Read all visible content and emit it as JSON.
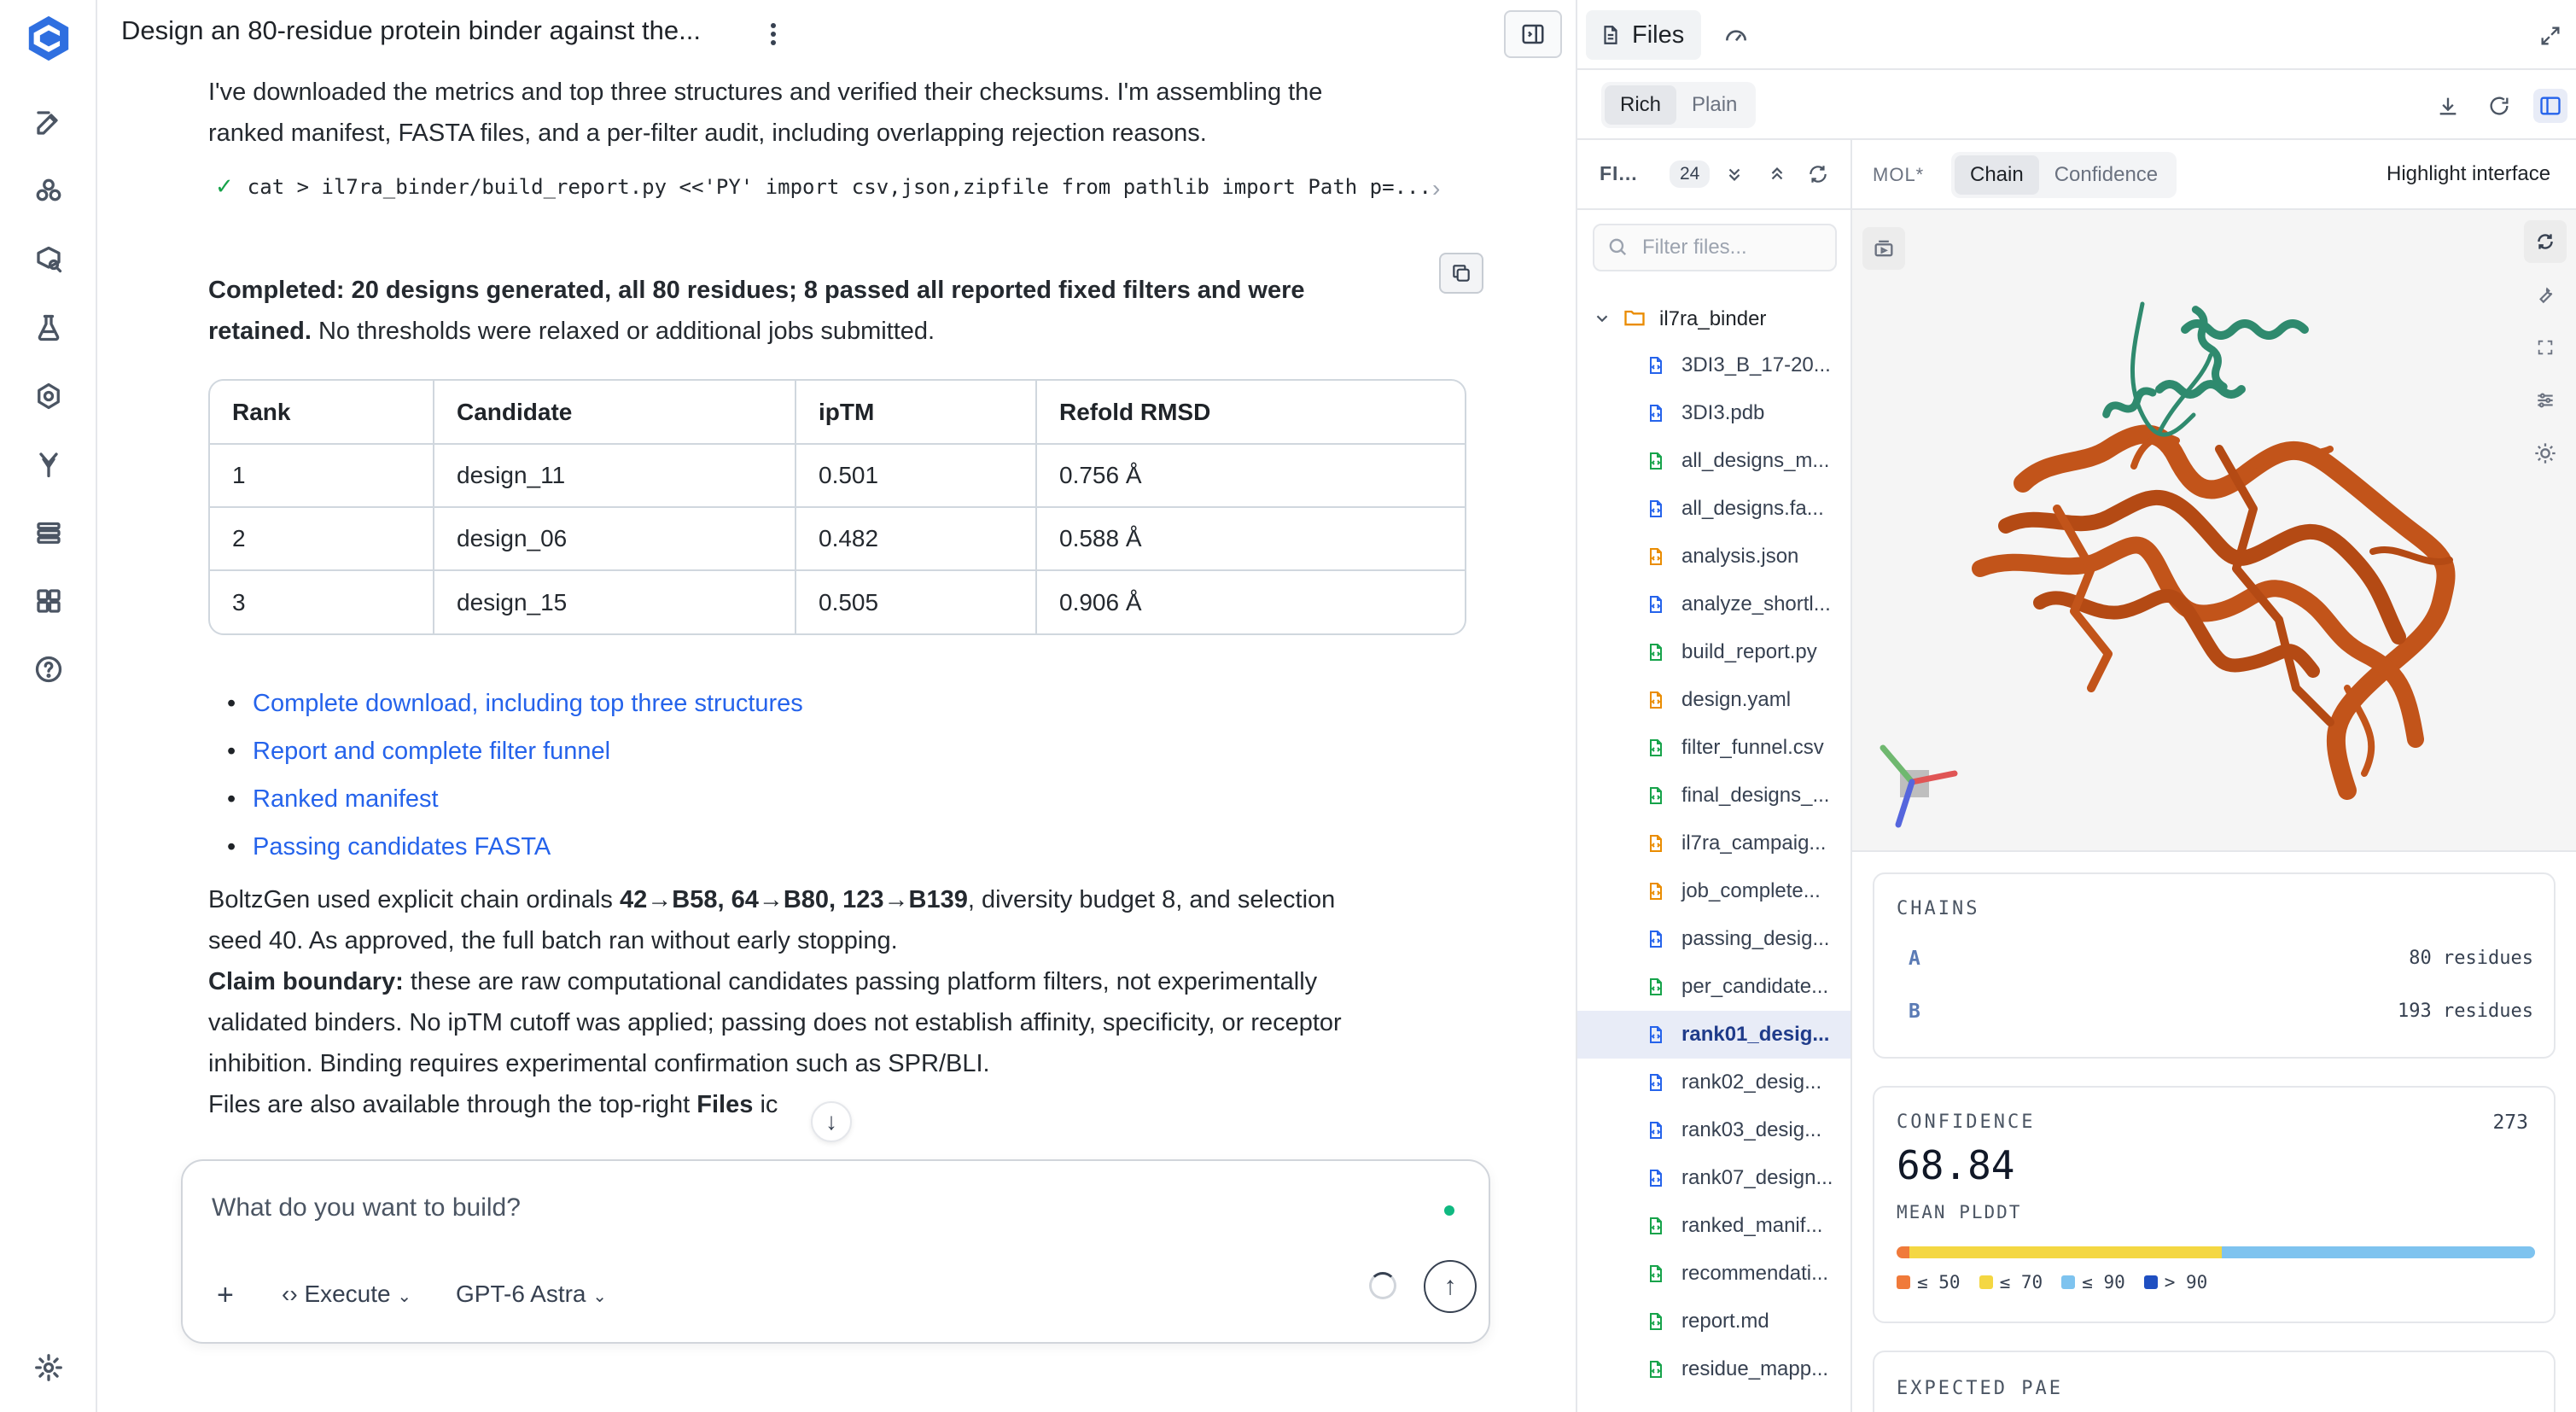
{
  "chat": {
    "title": "Design an 80-residue protein binder against the...",
    "intro_line1": "I've downloaded the metrics and top three structures and verified their checksums. I'm assembling the",
    "intro_line2": "ranked manifest, FASTA files, and a per-filter audit, including overlapping rejection reasons.",
    "command": "cat > il7ra_binder/build_report.py <<'PY' import csv,json,zipfile from pathlib import Path p=...",
    "completed_label": "Completed:",
    "completed_bold": "20 designs generated, all 80 residues; 8 passed all reported fixed filters and were",
    "completed_bold2": "retained.",
    "completed_rest": "No thresholds were relaxed or additional jobs submitted.",
    "table": {
      "headers": [
        "Rank",
        "Candidate",
        "ipTM",
        "Refold RMSD"
      ],
      "rows": [
        [
          "1",
          "design_11",
          "0.501",
          "0.756 Å"
        ],
        [
          "2",
          "design_06",
          "0.482",
          "0.588 Å"
        ],
        [
          "3",
          "design_15",
          "0.505",
          "0.906 Å"
        ]
      ]
    },
    "links": [
      "Complete download, including top three structures",
      "Report and complete filter funnel",
      "Ranked manifest",
      "Passing candidates FASTA"
    ],
    "boltz_pre": "BoltzGen used explicit chain ordinals",
    "boltz_bold": "42→B58, 64→B80, 123→B139",
    "boltz_post": ", diversity budget 8, and selection",
    "boltz_line2": "seed 40. As approved, the full batch ran without early stopping.",
    "claim_label": "Claim boundary:",
    "claim_rest1": "these are raw computational candidates passing platform filters, not experimentally",
    "claim_line2": "validated binders. No ipTM cutoff was applied; passing does not establish affinity, specificity, or receptor",
    "claim_line3": "inhibition. Binding requires experimental confirmation such as SPR/BLI.",
    "files_pre": "Files are also available through the top-right",
    "files_bold": "Files",
    "files_post": "ic"
  },
  "composer": {
    "placeholder": "What do you want to build?",
    "mode": "Execute",
    "model": "GPT-6 Astra"
  },
  "files_panel": {
    "tab_label": "Files",
    "view_modes": [
      "Rich",
      "Plain"
    ],
    "tree_title": "FI...",
    "file_count": "24",
    "filter_placeholder": "Filter files...",
    "folder": "il7ra_binder",
    "files": [
      {
        "name": "3DI3_B_17-20...",
        "color": "#2563eb"
      },
      {
        "name": "3DI3.pdb",
        "color": "#2563eb"
      },
      {
        "name": "all_designs_m...",
        "color": "#16a34a"
      },
      {
        "name": "all_designs.fa...",
        "color": "#2563eb"
      },
      {
        "name": "analysis.json",
        "color": "#ea8c00"
      },
      {
        "name": "analyze_shortl...",
        "color": "#2563eb"
      },
      {
        "name": "build_report.py",
        "color": "#16a34a"
      },
      {
        "name": "design.yaml",
        "color": "#ea8c00"
      },
      {
        "name": "filter_funnel.csv",
        "color": "#16a34a"
      },
      {
        "name": "final_designs_...",
        "color": "#16a34a"
      },
      {
        "name": "il7ra_campaig...",
        "color": "#ea8c00"
      },
      {
        "name": "job_complete...",
        "color": "#ea8c00"
      },
      {
        "name": "passing_desig...",
        "color": "#2563eb"
      },
      {
        "name": "per_candidate...",
        "color": "#16a34a"
      },
      {
        "name": "rank01_desig...",
        "color": "#2563eb",
        "selected": true
      },
      {
        "name": "rank02_desig...",
        "color": "#2563eb"
      },
      {
        "name": "rank03_desig...",
        "color": "#2563eb"
      },
      {
        "name": "rank07_design...",
        "color": "#2563eb"
      },
      {
        "name": "ranked_manif...",
        "color": "#16a34a"
      },
      {
        "name": "recommendati...",
        "color": "#16a34a"
      },
      {
        "name": "report.md",
        "color": "#16a34a"
      },
      {
        "name": "residue_mapp...",
        "color": "#16a34a"
      }
    ],
    "mol_label": "MOL*",
    "mol_modes": [
      "Chain",
      "Confidence"
    ],
    "highlight_label": "Highlight interface",
    "chains_title": "CHAINS",
    "chains": [
      {
        "id": "A",
        "residues": "80 residues"
      },
      {
        "id": "B",
        "residues": "193 residues"
      }
    ],
    "confidence_title": "CONFIDENCE",
    "confidence_count": "273",
    "confidence_value": "68.84",
    "confidence_sub": "MEAN PLDDT",
    "plddt_fractions": [
      0.02,
      0.49,
      0.49,
      0.0
    ],
    "legend": [
      {
        "label": "≤ 50",
        "color": "#f07a3a"
      },
      {
        "label": "≤ 70",
        "color": "#f4d742"
      },
      {
        "label": "≤ 90",
        "color": "#7ec3ef"
      },
      {
        "label": "> 90",
        "color": "#1f4fc1"
      }
    ],
    "pae_title": "EXPECTED PAE"
  },
  "colors": {
    "chain_a": "#2f8a6e",
    "chain_b": "#c2541a",
    "link": "#2563eb"
  }
}
